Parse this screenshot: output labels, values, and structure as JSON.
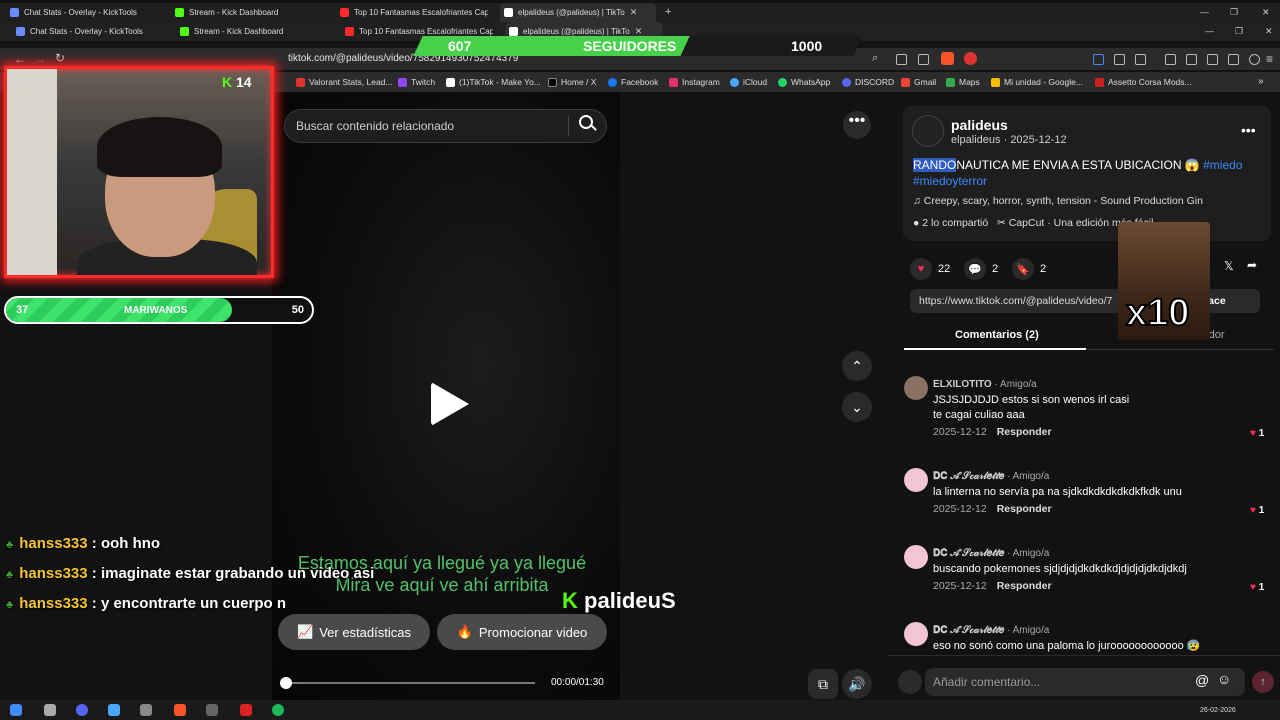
{
  "browser": {
    "tabs_row1": [
      {
        "title": "Chat Stats - Overlay - KickTools",
        "color": "#6b8cff"
      },
      {
        "title": "Stream - Kick Dashboard",
        "color": "#53fc18"
      },
      {
        "title": "Top 10 Fantasmas Escalofriantes Cap",
        "color": "#ff2b2b"
      },
      {
        "title": "elpalideus (@palideus) | TikTo",
        "color": "#ffffff",
        "active": true
      }
    ],
    "tabs_row2": [
      {
        "title": "Chat Stats - Overlay - KickTools",
        "color": "#6b8cff"
      },
      {
        "title": "Stream - Kick Dashboard",
        "color": "#53fc18"
      },
      {
        "title": "Top 10 Fantasmas Escalofriantes Cap",
        "color": "#ff2b2b"
      },
      {
        "title": "elpalideus (@palideus) | TikTo",
        "color": "#ffffff",
        "active": true
      }
    ],
    "url": "tiktok.com/@palideus/video/7582914930752474379",
    "bookmarks": [
      "Valorant Stats, Lead...",
      "Twitch",
      "(1)TikTok - Make Yo...",
      "Home / X",
      "Facebook",
      "Instagram",
      "iCloud",
      "WhatsApp",
      "DISCORD",
      "Gmail",
      "Maps",
      "Mi unidad - Google...",
      "Assetto Corsa Mods..."
    ]
  },
  "overlay": {
    "followers_current": "607",
    "followers_label": "SEGUIDORES",
    "followers_goal": "1000",
    "followers_progress": 0.607,
    "kick_count": "14",
    "goal_current": "37",
    "goal_label": "MARIWANOS",
    "goal_target": "50",
    "goal_progress": 0.74,
    "chat": [
      {
        "user": "hanss333",
        "message": ": ooh hno"
      },
      {
        "user": "hanss333",
        "message": ": imaginate estar grabando un video asi"
      },
      {
        "user": "hanss333",
        "message": ": y encontrarte un cuerpo n"
      }
    ],
    "kick_name": "palideuS",
    "meme_label": "x10"
  },
  "video": {
    "search_placeholder": "Buscar contenido relacionado",
    "subtitle": "Estamos aquí ya llegué ya ya llegué Mira ve aquí ve ahí arribita",
    "stats_button": "Ver estadísticas",
    "promote_button": "Promocionar video",
    "time": "00:00/01:30",
    "progress": 0.0
  },
  "post": {
    "display_name": "palideus",
    "sub": "elpalideus · 2025-12-12",
    "desc_highlight": "RANDO",
    "desc_rest": "NAUTICA ME ENVIA A ESTA UBICACION 😱 ",
    "hashtag1": "#miedo",
    "hashtag2": "#miedoyterror",
    "sound": "♫  Creepy, scary, horror, synth, tension - Sound Production Gin",
    "shared": "2 lo compartió",
    "capcut": "CapCut · Una edición más fácil",
    "likes": "22",
    "comments_count": "2",
    "saves": "2",
    "link": "https://www.tiktok.com/@palideus/video/7",
    "copy_link": "r enlace",
    "tab_comments": "Comentarios (2)",
    "tab_creator": "Videos del creador"
  },
  "comments": [
    {
      "user": "ELXILOTITO",
      "badge": "· Amigo/a",
      "text": "JSJSJDJDJD estos si son wenos irl casi te cagai culiao aaa",
      "date": "2025-12-12",
      "reply": "Responder",
      "likes": "1"
    },
    {
      "user": "𝐃𝐂 𝒜'𝒮𝒸𝒶𝓇𝓁𝑒𝓉𝓉𝑒",
      "badge": "· Amigo/a",
      "text": "la linterna no servía pa na sjdkdkdkdkdkdkfkdk unu",
      "date": "2025-12-12",
      "reply": "Responder",
      "likes": "1"
    },
    {
      "user": "𝐃𝐂 𝒜'𝒮𝒸𝒶𝓇𝓁𝑒𝓉𝓉𝑒",
      "badge": "· Amigo/a",
      "text": "buscando pokemones sjdjdjdjdkdkdkdjdjdjdjdkdjdkdj",
      "date": "2025-12-12",
      "reply": "Responder",
      "likes": "1"
    },
    {
      "user": "𝐃𝐂 𝒜'𝒮𝒸𝒶𝓇𝓁𝑒𝓉𝓉𝑒",
      "badge": "· Amigo/a",
      "text": "eso no sonó como una paloma lo juroooooooooooo 😰",
      "date": "",
      "reply": "",
      "likes": ""
    }
  ],
  "comment_input": {
    "placeholder": "Añadir comentario..."
  },
  "taskbar": {
    "date": "26-02-2026"
  }
}
